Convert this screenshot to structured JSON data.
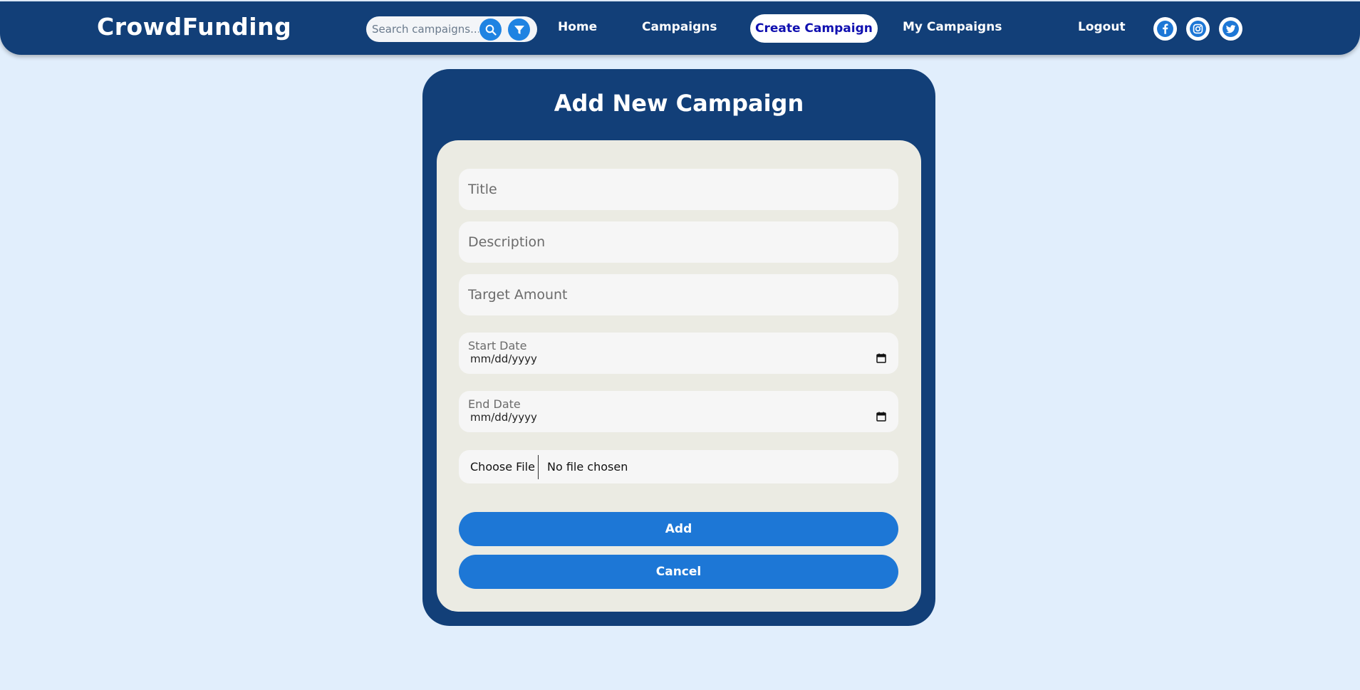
{
  "header": {
    "logo": "CrowdFunding",
    "search_placeholder": "Search campaigns...",
    "search_icon": "search-icon",
    "filter_icon": "filter-icon",
    "nav": {
      "home": "Home",
      "campaigns": "Campaigns",
      "create_campaign": "Create Campaign",
      "my_campaigns": "My Campaigns",
      "logout": "Logout"
    },
    "social_icons": [
      "facebook-icon",
      "instagram-icon",
      "twitter-icon"
    ]
  },
  "form": {
    "title": "Add New Campaign",
    "title_placeholder": "Title",
    "description_placeholder": "Description",
    "target_amount_placeholder": "Target Amount",
    "start_date_label": "Start Date",
    "start_date_value": "mm/dd/yyyy",
    "end_date_label": "End Date",
    "end_date_value": "mm/dd/yyyy",
    "choose_file_label": "Choose File",
    "file_status": "No file chosen",
    "add_label": "Add",
    "cancel_label": "Cancel"
  },
  "colors": {
    "header_bg": "#123f78",
    "page_bg": "#e1eefc",
    "panel_bg": "#ebebe3",
    "button_bg": "#1d77d6",
    "active_nav_text": "#1010b0"
  }
}
